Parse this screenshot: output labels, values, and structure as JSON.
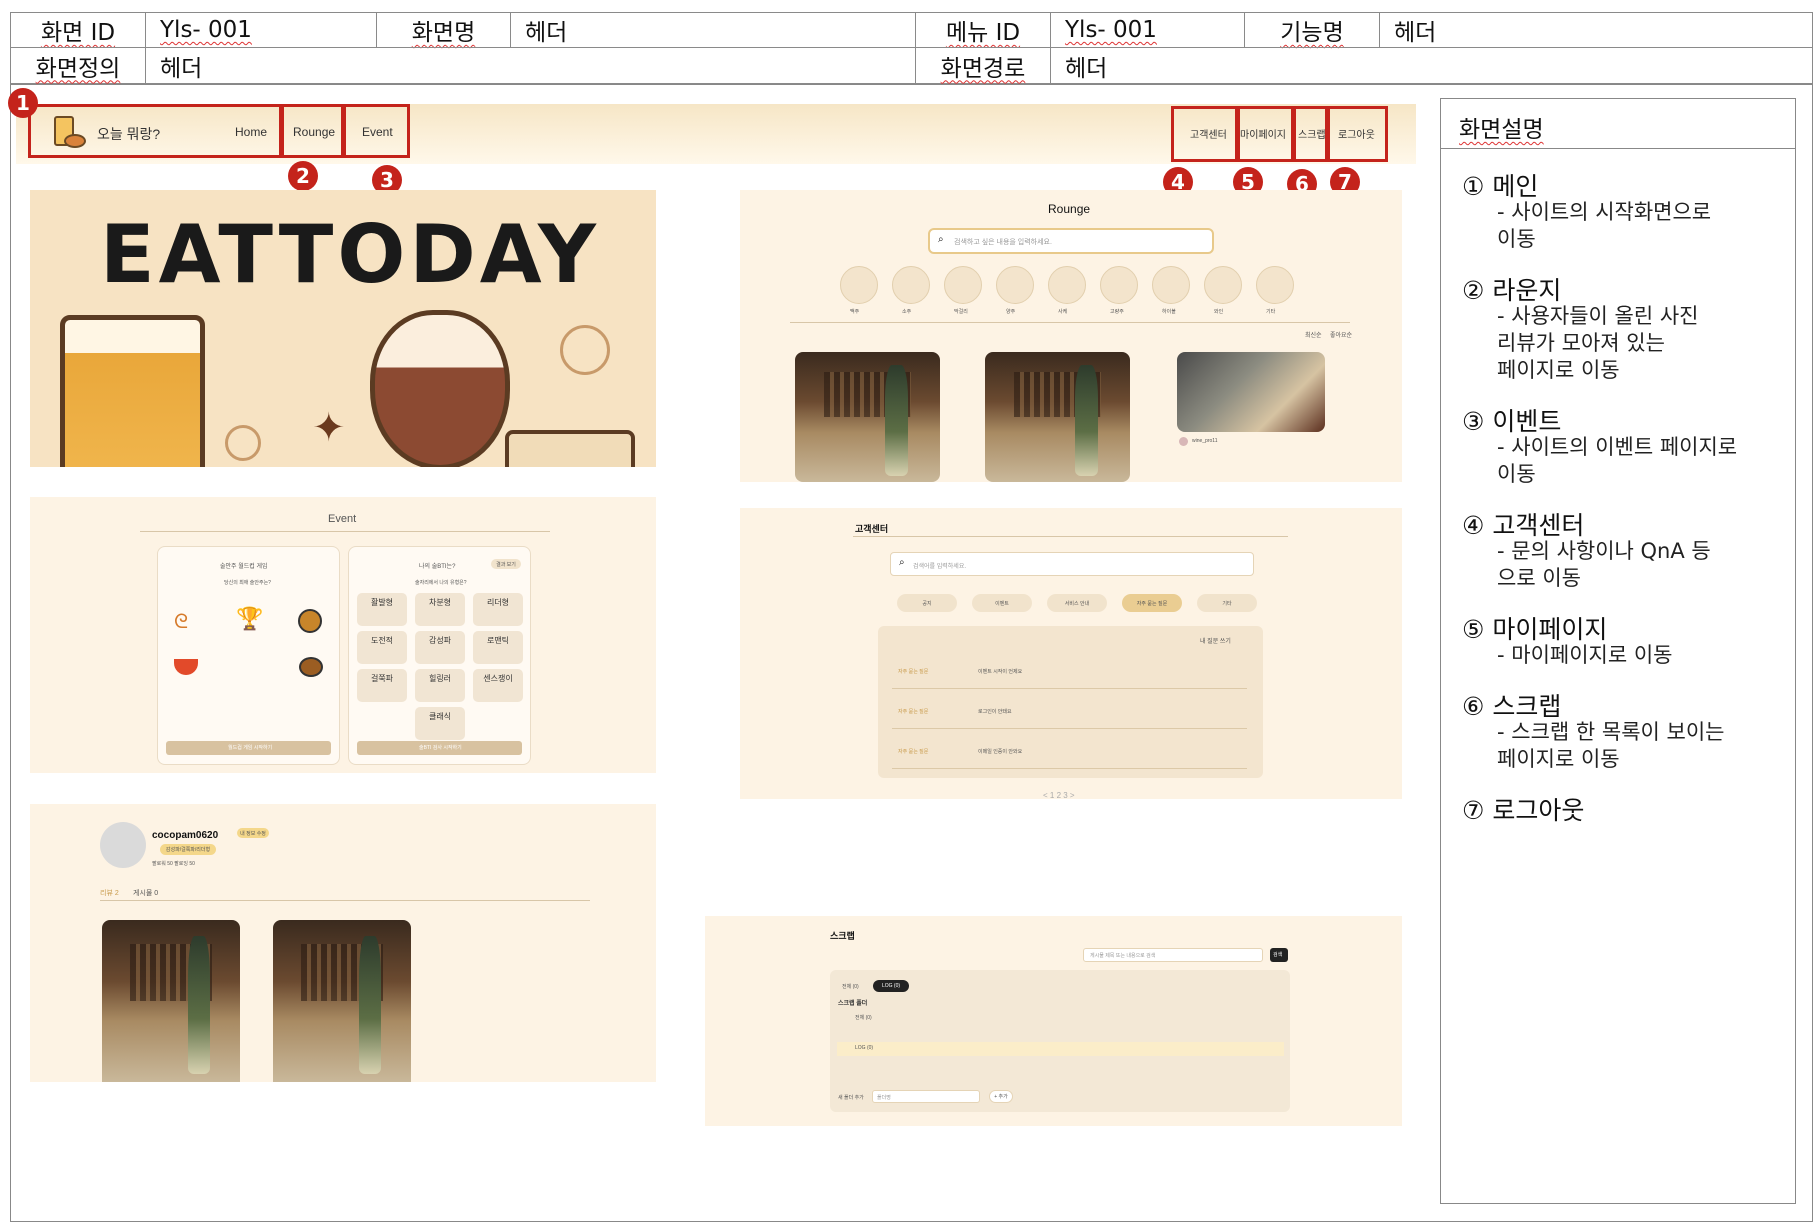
{
  "header": {
    "screen_id_label": "화면 ID",
    "screen_id_value": "Yls- 001",
    "screen_name_label": "화면명",
    "screen_name_value": "헤더",
    "menu_id_label": "메뉴 ID",
    "menu_id_value": "Yls- 001",
    "function_name_label": "기능명",
    "function_name_value": "헤더",
    "screen_def_label": "화면정의",
    "screen_def_value": "헤더",
    "screen_path_label": "화면경로",
    "screen_path_value": "헤더"
  },
  "nav": {
    "logo_text": "오늘 뭐랑?",
    "home": "Home",
    "rounge": "Rounge",
    "event": "Event",
    "customer_center": "고객센터",
    "mypage": "마이페이지",
    "scrap": "스크랩",
    "logout": "로그아웃"
  },
  "badges": [
    "1",
    "2",
    "3",
    "4",
    "5",
    "6",
    "7"
  ],
  "hero": {
    "title": "EATTODAY"
  },
  "rounge_preview": {
    "title": "Rounge",
    "search_placeholder": "검색하고 싶은 내용을 입력하세요.",
    "categories": [
      "맥주",
      "소주",
      "막걸리",
      "양주",
      "사케",
      "고량주",
      "하이볼",
      "와인",
      "기타"
    ],
    "sort": [
      "최신순",
      "좋아요순"
    ],
    "post_user": "wine_pro11"
  },
  "event_preview": {
    "title": "Event",
    "card1_title": "술안주 월드컵 게임",
    "card1_sub": "당신의 최애 술안주는?",
    "card1_button": "월드컵 게임 시작하기",
    "card2_title": "나의 술BTI는?",
    "card2_tag": "결과 보기",
    "card2_sub": "술자리에서 나의 유형은?",
    "card2_button": "술BTI 검사 시작하기",
    "types": [
      "활발형",
      "차분형",
      "리더형",
      "도전적",
      "감성파",
      "로맨틱",
      "걸쭉파",
      "힐링러",
      "센스쟁이",
      "클래식"
    ]
  },
  "mypage_preview": {
    "username": "cocopam0620",
    "tag": "내 정보 수정",
    "type_chip": "감성파/걸쭉파/리더형",
    "follow": "팔로워 50 팔로잉 50",
    "tab_review": "리뷰 2",
    "tab_post": "게시물 0"
  },
  "support_preview": {
    "title": "고객센터",
    "search_placeholder": "검색어를 입력하세요.",
    "tabs": [
      "공지",
      "이벤트",
      "서비스 안내",
      "자주 묻는 질문",
      "기타"
    ],
    "my_question": "내 질문 쓰기",
    "questions": [
      {
        "cat": "자주 묻는 질문",
        "title": "이벤트 시작이 언제요"
      },
      {
        "cat": "자주 묻는 질문",
        "title": "로그인이 안돼요"
      },
      {
        "cat": "자주 묻는 질문",
        "title": "이메일 인증이 안와요"
      }
    ],
    "pagination": "< 1 2 3 >"
  },
  "scrap_preview": {
    "title": "스크랩",
    "search_placeholder": "게시물 제목 또는 내용으로 검색",
    "search_button": "검색",
    "filter_all": "전체 (0)",
    "filter_sel": "LOG (0)",
    "folder_title": "스크랩 폴더",
    "folder1": "전체 (0)",
    "folder2": "LOG (0)",
    "new_folder_label": "새 폴더 추가",
    "new_folder_placeholder": "폴더명",
    "add_button": "+ 추가"
  },
  "description": {
    "title": "화면설명",
    "items": [
      {
        "num": "①",
        "title": "메인",
        "lines": [
          "- 사이트의 시작화면으로",
          "이동"
        ]
      },
      {
        "num": "②",
        "title": "라운지",
        "lines": [
          "- 사용자들이 올린 사진",
          "리뷰가 모아져 있는",
          "페이지로 이동"
        ]
      },
      {
        "num": "③",
        "title": "이벤트",
        "lines": [
          "- 사이트의 이벤트 페이지로",
          "이동"
        ]
      },
      {
        "num": "④",
        "title": "고객센터",
        "lines": [
          "- 문의 사항이나 QnA 등",
          "으로 이동"
        ]
      },
      {
        "num": "⑤",
        "title": "마이페이지",
        "lines": [
          "- 마이페이지로 이동"
        ]
      },
      {
        "num": "⑥",
        "title": "스크랩",
        "lines": [
          "- 스크랩 한 목록이 보이는",
          "페이지로 이동"
        ]
      },
      {
        "num": "⑦",
        "title": "로그아웃",
        "lines": []
      }
    ]
  },
  "colors": {
    "accent_red": "#c4231b",
    "cream": "#fdf3e4",
    "beige": "#f1e3cc"
  }
}
